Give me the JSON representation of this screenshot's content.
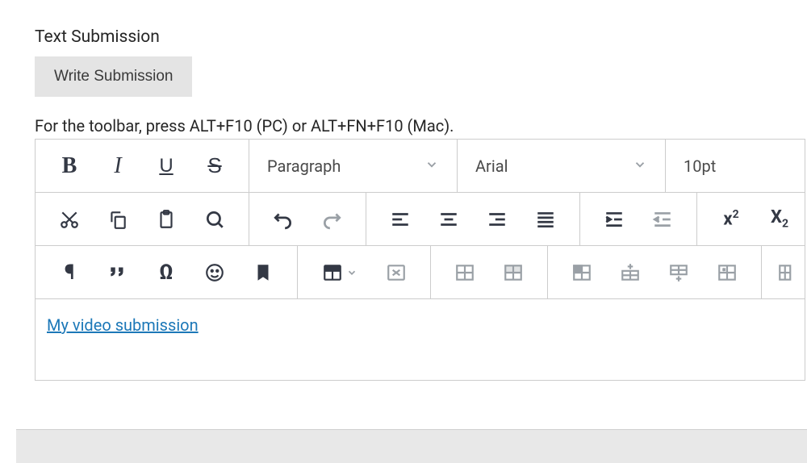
{
  "section_title": "Text Submission",
  "write_submission_label": "Write Submission",
  "toolbar_hint": "For the toolbar, press ALT+F10 (PC) or ALT+FN+F10 (Mac).",
  "dropdowns": {
    "paragraph": "Paragraph",
    "font": "Arial",
    "size": "10pt"
  },
  "content": {
    "link_text": "My video submission"
  }
}
